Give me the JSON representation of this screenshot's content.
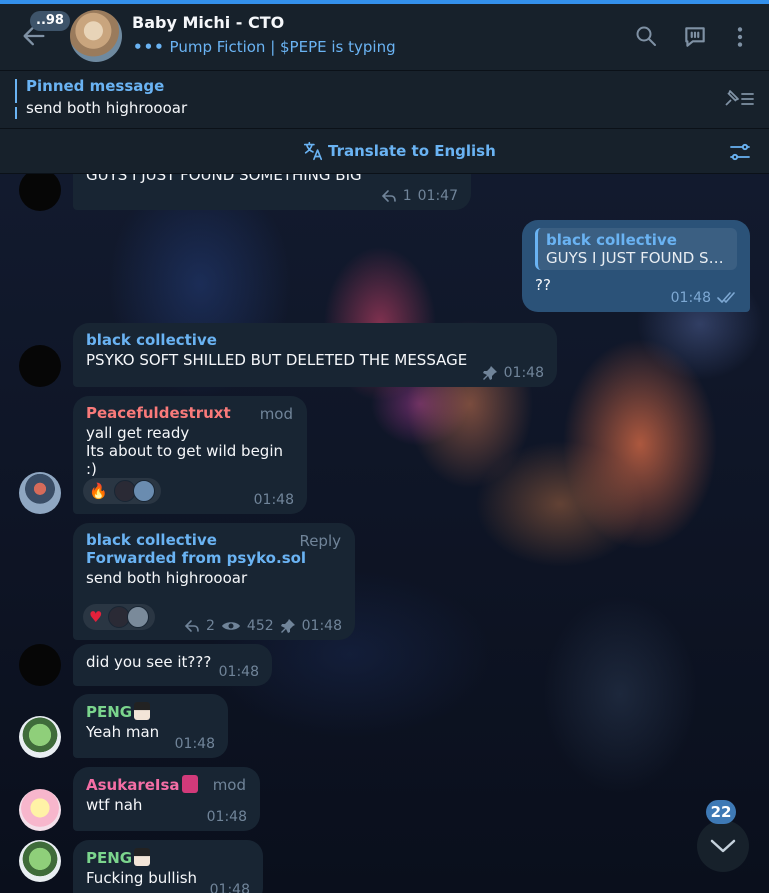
{
  "header": {
    "unread_count": "..98",
    "title": "Baby Michi - CTO",
    "typing_dots": "•••",
    "typing_status": "Pump Fiction | $PEPE is typing"
  },
  "pinned": {
    "title": "Pinned message",
    "text": "send both highroooar"
  },
  "translate": {
    "label": "Translate to English"
  },
  "messages": [
    {
      "text": "GUYS I JUST FOUND SOMETHING BIG",
      "replies": "1",
      "time": "01:47"
    },
    {
      "reply_to_name": "black collective",
      "reply_to_text": "GUYS I JUST FOUND SOMETHING BIG",
      "text": "??",
      "time": "01:48"
    },
    {
      "sender": "black collective",
      "text": "PSYKO SOFT SHILLED BUT DELETED THE MESSAGE",
      "time": "01:48"
    },
    {
      "sender": "Peacefuldestruxt",
      "role": "mod",
      "line1": "yall get ready",
      "line2": "Its about to get wild begin :)",
      "reaction": "🔥",
      "time": "01:48"
    },
    {
      "sender": "black collective",
      "action": "Reply",
      "forwarded": "Forwarded from psyko.sol",
      "text": "send both highroooar",
      "reaction": "♥",
      "replies": "2",
      "views": "452",
      "time": "01:48"
    },
    {
      "text": "did you see it???",
      "time": "01:48"
    },
    {
      "sender": "PENG",
      "text": "Yeah man",
      "time": "01:48"
    },
    {
      "sender": "AsukareIsa",
      "role": "mod",
      "text": "wtf nah",
      "time": "01:48"
    },
    {
      "sender": "PENG",
      "text": "Fucking bullish",
      "time": "01:48"
    }
  ],
  "scroll": {
    "unread": "22"
  },
  "colors": {
    "accent": "#6ab3f3",
    "bubble_in": "#182533",
    "bubble_out": "#2b5278",
    "header_bg": "#17212b"
  }
}
